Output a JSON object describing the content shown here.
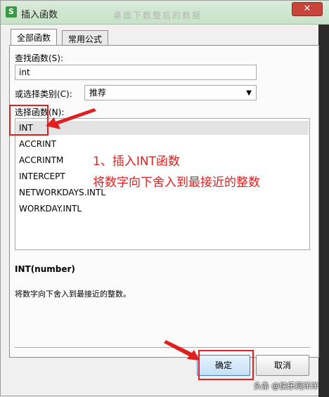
{
  "window": {
    "title": "插入函数",
    "background_title": "桌面下数整后的数据",
    "icon_letter": "S",
    "close_glyph": "✕"
  },
  "tabs": [
    {
      "label": "全部函数",
      "active": true
    },
    {
      "label": "常用公式",
      "active": false
    }
  ],
  "search": {
    "label": "查找函数(S):",
    "value": "int"
  },
  "category": {
    "label": "或选择类别(C):",
    "selected": "推荐"
  },
  "function_list": {
    "label": "选择函数(N):",
    "items": [
      "INT",
      "ACCRINT",
      "ACCRINTM",
      "INTERCEPT",
      "NETWORKDAYS.INTL",
      "WORKDAY.INTL"
    ],
    "selected_index": 0
  },
  "signature": "INT(number)",
  "description": "将数字向下舍入到最接近的整数。",
  "buttons": {
    "ok": "确定",
    "cancel": "取消"
  },
  "annotation": {
    "line1": "1、插入INT函数",
    "line2": "将数字向下舍入到最接近的整数",
    "color": "#e02020"
  },
  "watermark": "头条 @快乐祠洋洋"
}
